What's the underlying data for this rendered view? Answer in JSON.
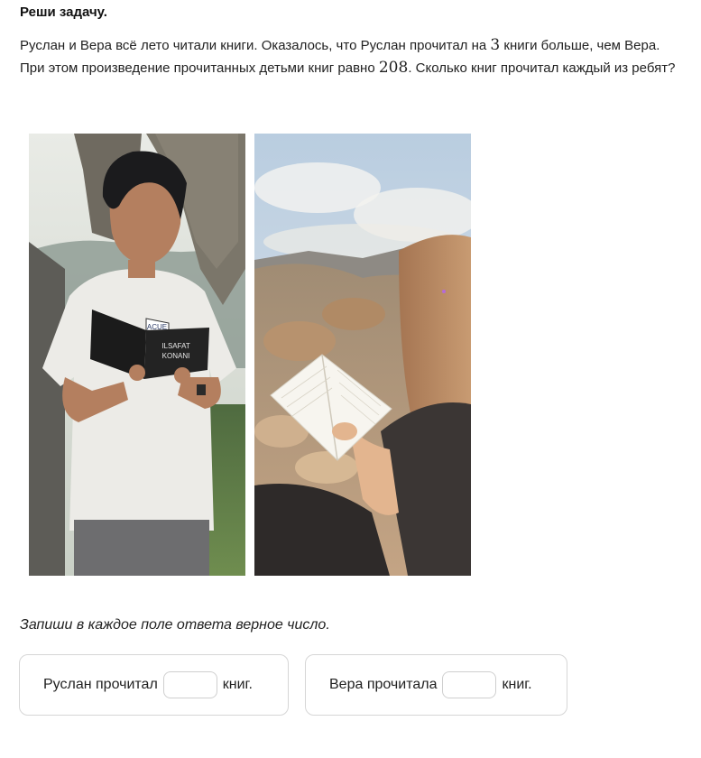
{
  "task": {
    "heading": "Реши задачу.",
    "problem_part1": "Руслан и Вера всё лето читали книги. Оказалось, что Руслан прочитал на ",
    "difference": "3",
    "problem_part2": " книги больше, чем Вера. При этом произведение прочитанных детьми книг равно ",
    "product": "208",
    "problem_part3": ". Сколько книг прочитал каждый из ребят?"
  },
  "images": {
    "boy": "photo of a boy reading a book",
    "girl": "photo of a girl reading a book"
  },
  "book_cover": {
    "line1": "ILSAFAT",
    "line2": "KONANI"
  },
  "shirt_logo": "ACUE",
  "instruction": "Запиши в каждое поле ответа верное число.",
  "answers": {
    "ruslan": {
      "prefix": "Руслан прочитал",
      "value": "",
      "suffix": "книг."
    },
    "vera": {
      "prefix": "Вера прочитала",
      "value": "",
      "suffix": "книг."
    }
  }
}
